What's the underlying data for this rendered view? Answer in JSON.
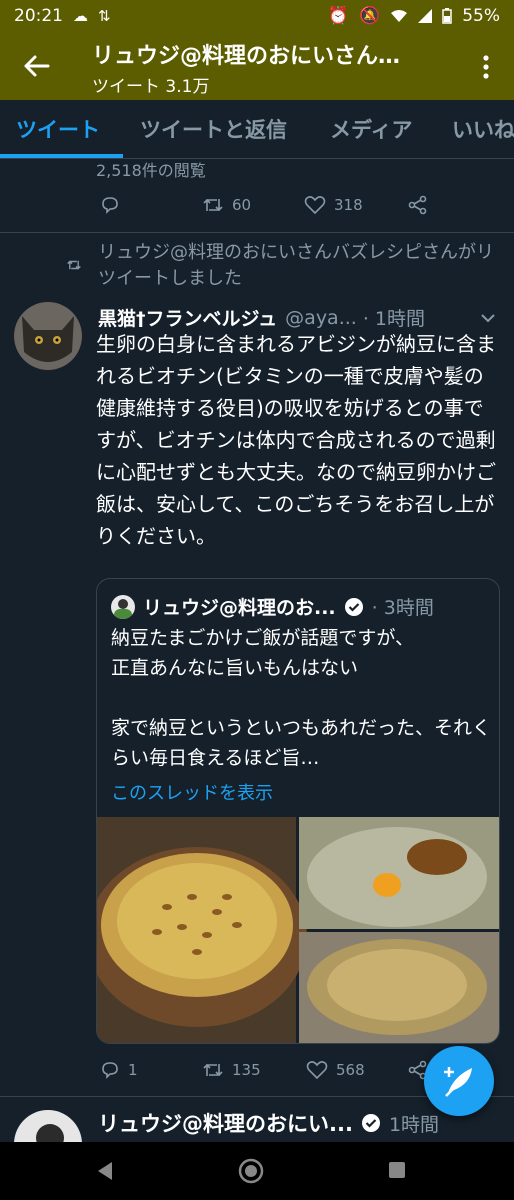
{
  "status_bar": {
    "time": "20:21",
    "battery": "55%"
  },
  "header": {
    "title": "リュウジ@料理のおにいさん…",
    "subtitle": "ツイート 3.1万"
  },
  "tabs": [
    {
      "label": "ツイート",
      "active": true
    },
    {
      "label": "ツイートと返信",
      "active": false
    },
    {
      "label": "メディア",
      "active": false
    },
    {
      "label": "いいね",
      "active": false
    }
  ],
  "prev_tweet": {
    "views": "2,518件の閲覧",
    "retweets": "60",
    "likes": "318"
  },
  "retweet_label": "リュウジ@料理のおにいさんバズレシピさんがリツイートしました",
  "tweet": {
    "name": "黒猫†フランベルジュ",
    "handle": "@aya...",
    "time": "· 1時間",
    "text": "生卵の白身に含まれるアビジンが納豆に含まれるビオチン(ビタミンの一種で皮膚や髪の健康維持する役目)の吸収を妨げるとの事ですが、ビオチンは体内で合成されるので過剰に心配せずとも大丈夫。なので納豆卵かけご飯は、安心して、このごちそうをお召し上がりください。",
    "replies": "1",
    "retweets": "135",
    "likes": "568"
  },
  "quote": {
    "name": "リュウジ@料理のお...",
    "time": "· 3時間",
    "text_line1": "納豆たまごかけご飯が話題ですが、",
    "text_line2": "正直あんなに旨いもんはない",
    "text_line3": "家で納豆というといつもあれだった、それくらい毎日食えるほど旨…",
    "show_thread": "このスレッドを表示"
  },
  "next_tweet": {
    "name": "リュウジ@料理のおにい...",
    "time": "1時間"
  },
  "colors": {
    "background": "#15202b",
    "header": "#5c5c00",
    "accent": "#1da1f2",
    "muted": "#8899a6",
    "divider": "#38444d"
  }
}
